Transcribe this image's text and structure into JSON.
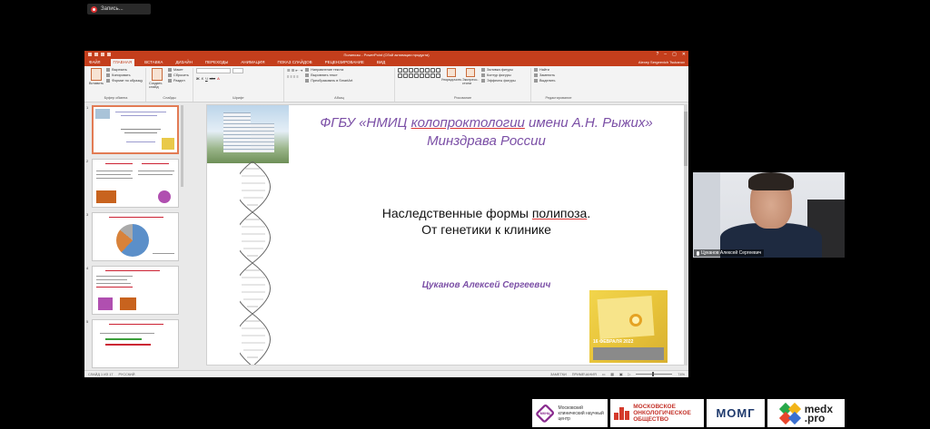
{
  "recording": {
    "label": "Запись..."
  },
  "ppt": {
    "window_title": "Полипозы - PowerPoint (Сбой активации продукта)",
    "user": "Alexey Sergeevich Tsukanov",
    "tabs": [
      "ФАЙЛ",
      "ГЛАВНАЯ",
      "ВСТАВКА",
      "ДИЗАЙН",
      "ПЕРЕХОДЫ",
      "АНИМАЦИЯ",
      "ПОКАЗ СЛАЙДОВ",
      "РЕЦЕНЗИРОВАНИЕ",
      "ВИД"
    ],
    "ribbon": {
      "clipboard": {
        "paste": "Вставить",
        "cut": "Вырезать",
        "copy": "Копировать",
        "format_painter": "Формат по образцу",
        "group": "Буфер обмена"
      },
      "slides": {
        "new_slide": "Создать слайд",
        "layout": "Макет",
        "reset": "Сбросить",
        "section": "Раздел",
        "group": "Слайды"
      },
      "font": {
        "group": "Шрифт"
      },
      "paragraph": {
        "text_direction": "Направление текста",
        "align_text": "Выровнять текст",
        "smartart": "Преобразовать в SmartArt",
        "group": "Абзац"
      },
      "drawing": {
        "arrange": "Упорядочить",
        "quick_styles": "Экспресс-стили",
        "fill": "Заливка фигуры",
        "outline": "Контур фигуры",
        "effects": "Эффекты фигуры",
        "group": "Рисование"
      },
      "editing": {
        "find": "Найти",
        "replace": "Заменить",
        "select": "Выделить",
        "group": "Редактирование"
      }
    },
    "thumbnails": [
      {
        "num": "1"
      },
      {
        "num": "2"
      },
      {
        "num": "3"
      },
      {
        "num": "4"
      },
      {
        "num": "5"
      }
    ],
    "slide": {
      "org_line1_a": "ФГБУ «НМИЦ ",
      "org_line1_u": "колопроктологии",
      "org_line1_b": " имени А.Н. Рыжих»",
      "org_line2": "Минздрава России",
      "title_a": "Наследственные формы ",
      "title_u": "полипоза",
      "title_b": ".",
      "title_line2": "От генетики к клинике",
      "author": "Цуканов Алексей Сергеевич",
      "poster_date": "16 ФЕВРАЛЯ 2022"
    },
    "status": {
      "slide_count": "СЛАЙД 1 ИЗ 17",
      "language": "РУССКИЙ",
      "notes": "ЗАМЕТКИ",
      "comments": "ПРИМЕЧАНИЯ",
      "zoom": "74%"
    }
  },
  "webcam": {
    "name": "Цуканов Алексей Сергеевич"
  },
  "sponsors": {
    "mknc_abbr": "МКНЦ",
    "mknc_name": "Московский клинический научный центр",
    "moo_name": "МОСКОВСКОЕ ОНКОЛОГИЧЕСКОЕ ОБЩЕСТВО",
    "momg": "МОМГ",
    "medx_1": "medx",
    "medx_2": ".pro"
  },
  "colors": {
    "ppt_accent": "#c43e1c",
    "slide_purple": "#7b4fa6"
  }
}
